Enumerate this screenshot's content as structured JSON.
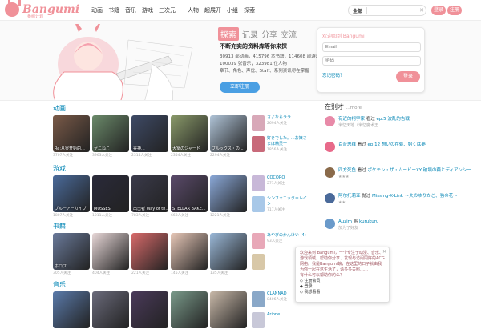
{
  "header": {
    "logo": "Bangumi",
    "logo_sub": "番组计划",
    "nav": [
      "动画",
      "书籍",
      "音乐",
      "游戏",
      "三次元",
      "人物",
      "超展开",
      "小组",
      "探索"
    ],
    "search_scope": "全部",
    "search_placeholder": "",
    "login": "登录",
    "register": "注册"
  },
  "hero": {
    "tabs": [
      "探索",
      "记录",
      "分享",
      "交流"
    ],
    "slogan": "不断充实的资料库等你来探",
    "stats_1": "30913 部动画，415796 本书籍，114608 部游戏",
    "stats_2": "100039 张音乐，323981 位人物",
    "stats_3": "章节、角色、声优、Staff、系列资讯尽在掌握",
    "cta": "立即注册"
  },
  "login_panel": {
    "title": "欢迎回到 Bangumi",
    "email_placeholder": "Email",
    "password_placeholder": "密码",
    "forgot": "忘记密码？",
    "submit": "登录"
  },
  "sections": [
    {
      "title": "动画",
      "tiles": [
        {
          "cap": "Re:从零开始的...",
          "meta": "3707人关注",
          "color": "#7a5a48"
        },
        {
          "cap": "ヤニねこ",
          "meta": "3963人关注",
          "color": "#6b8a6a"
        },
        {
          "cap": "谷神...",
          "meta": "2314人关注",
          "color": "#3e4a66"
        },
        {
          "cap": "大室のジャード",
          "meta": "2354人关注",
          "color": "#8a9a6a"
        },
        {
          "cap": "ブルックス・の...",
          "meta": "2294人关注",
          "color": "#b0c4d8"
        }
      ],
      "side": [
        {
          "t": "さよならララ",
          "s": "2694人关注",
          "color": "#d8a8b8"
        },
        {
          "t": "好きでした。...お嬢さまは精灵一",
          "s": "1856人关注",
          "color": "#c86a7a"
        }
      ]
    },
    {
      "title": "游戏",
      "tiles": [
        {
          "cap": "ブルーアーカイブ",
          "meta": "1807人关注",
          "color": "#4a6a9a"
        },
        {
          "cap": "MUSSES",
          "meta": "1011人关注",
          "color": "#2a2a3a"
        },
        {
          "cap": "出击者 Way of th...",
          "meta": "783人关注",
          "color": "#3a3a4a"
        },
        {
          "cap": "STELLAR BAKE...",
          "meta": "668人关注",
          "color": "#5a4a6a"
        },
        {
          "cap": "",
          "meta": "1221人关注",
          "color": "#8aa8d8"
        }
      ],
      "side": [
        {
          "t": "COCORO",
          "s": "271人关注",
          "color": "#c8b8d8"
        },
        {
          "t": "シンフォニック＝レイン",
          "s": "717人关注",
          "color": "#a8c8e8"
        }
      ]
    },
    {
      "title": "书籍",
      "tiles": [
        {
          "cap": "ホロフ...",
          "meta": "305人关注",
          "color": "#6a7a9a"
        },
        {
          "cap": "",
          "meta": "404人关注",
          "color": "#e8d8d8"
        },
        {
          "cap": "",
          "meta": "221人关注",
          "color": "#d86a6a"
        },
        {
          "cap": "",
          "meta": "145人关注",
          "color": "#e8c8b8"
        },
        {
          "cap": "",
          "meta": "135人关注",
          "color": "#9ab8d8"
        }
      ],
      "side": [
        {
          "t": "あやびのかんけい (4)",
          "s": "93人关注",
          "color": "#e8a8b8"
        },
        {
          "t": "",
          "s": "",
          "color": "#d8c8a8"
        }
      ]
    },
    {
      "title": "音乐",
      "tiles": [
        {
          "cap": "",
          "meta": "",
          "color": "#5a7aaa"
        },
        {
          "cap": "",
          "meta": "",
          "color": "#6a6a7a"
        },
        {
          "cap": "",
          "meta": "",
          "color": "#4a3a5a"
        },
        {
          "cap": "",
          "meta": "",
          "color": "#7a9a8a"
        },
        {
          "cap": "",
          "meta": "",
          "color": "#c8b8a8"
        }
      ],
      "side": [
        {
          "t": "CLANNAD",
          "s": "8406人关注",
          "color": "#8aa8c8"
        },
        {
          "t": "Arione",
          "s": "",
          "color": "#c8c8d8"
        }
      ]
    }
  ],
  "right": {
    "title": "在别才",
    "more": "...more",
    "items": [
      {
        "user": "有近的柯宇家",
        "action": "看过",
        "target": "ep.5 波乱的告戦",
        "sub": "米忆天地（米忆魔术王...",
        "color": "#e88aa8"
      },
      {
        "user": "百合思维",
        "action": "看过",
        "target": "ep.12 想いの在処、始くは夢",
        "sub": "",
        "color": "#e86a8a"
      },
      {
        "user": "四方死鱼",
        "action": "看过",
        "target": "ポケモン・ザ・ムービーXY 破壊の繭とディアンシー",
        "sub": "★★★",
        "color": "#8a6a4a"
      },
      {
        "user": "阿尔托莉亚",
        "action": "抛过",
        "target": "Missing-X-Link ～夫のゆりかご、強の花～",
        "sub": "★★",
        "color": "#4a6a9a"
      },
      {
        "user": "Auzim",
        "action": "将",
        "target": "kurukuru",
        "sub": "加为了好友",
        "color": "#6a9aca"
      }
    ]
  },
  "popup": {
    "text": "欢迎来到 Bangumi，一个专注于动漫、音乐、游戏领域，帮助你分享、发现与访问同好的ACG网络。我是Bangumi娘，在这里的日子就由我为你一起在这生活了，请多多关照……",
    "question": "有什么可以帮助你的么？",
    "options": [
      "注册会员",
      "登录",
      "我想看看"
    ]
  }
}
